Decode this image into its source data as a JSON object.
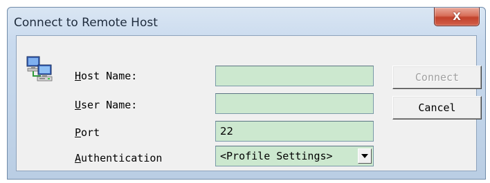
{
  "window": {
    "title": "Connect to Remote Host",
    "close_glyph": "X"
  },
  "form": {
    "host_name": {
      "label_accel": "H",
      "label_rest": "ost Name:",
      "value": ""
    },
    "user_name": {
      "label_accel": "U",
      "label_rest": "ser Name:",
      "value": ""
    },
    "port": {
      "label_accel": "P",
      "label_rest": "ort",
      "value": "22"
    },
    "authentication": {
      "label_accel": "A",
      "label_rest": "uthentication",
      "selected": "<Profile Settings>"
    }
  },
  "buttons": {
    "connect": {
      "label": "Connect",
      "enabled": false
    },
    "cancel": {
      "label": "Cancel",
      "enabled": true
    }
  },
  "icons": {
    "app_icon": "networked-computers-icon",
    "close_icon": "close-icon",
    "dropdown_icon": "chevron-down-icon"
  },
  "colors": {
    "field_background": "#cce8cf",
    "close_button": "#c2422c"
  }
}
